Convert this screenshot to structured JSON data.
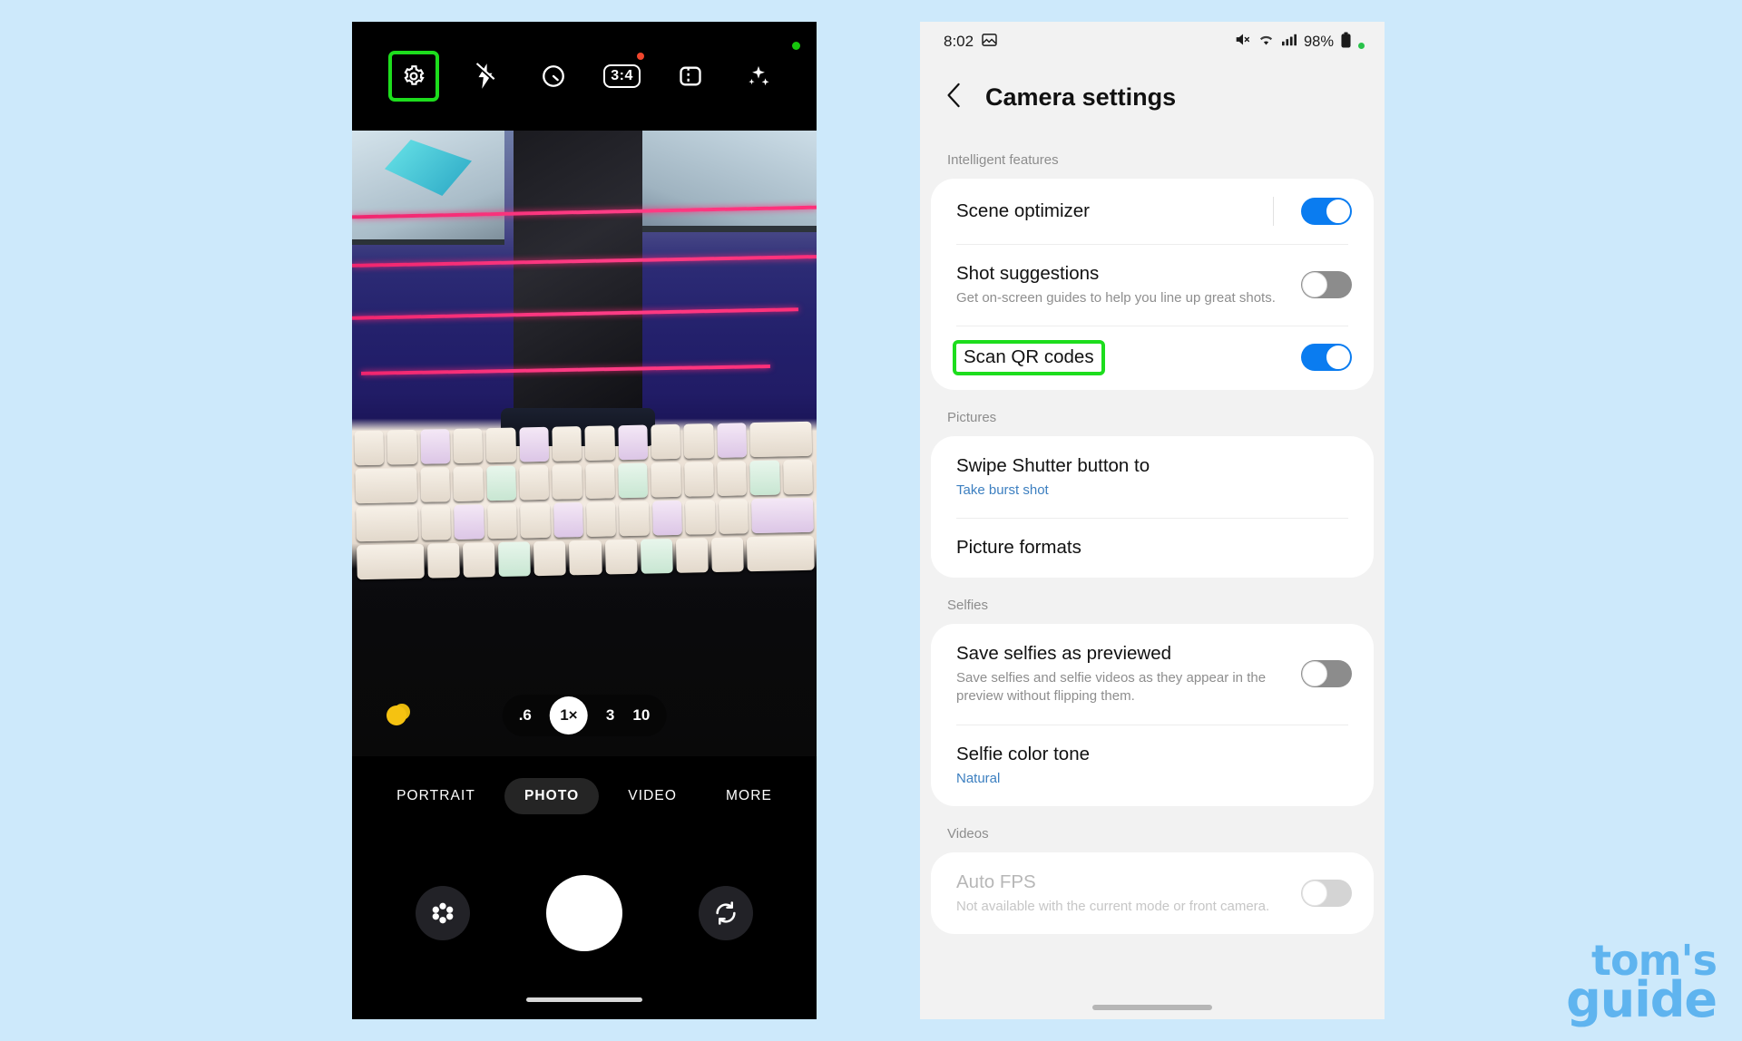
{
  "background_color": "#cde9fb",
  "highlight_color": "#1ddd1d",
  "accent_blue": "#0a7cf0",
  "camera_phone": {
    "toolbar": {
      "settings_icon": "gear-icon",
      "flash_icon": "flash-off-icon",
      "timer_icon": "timer-icon",
      "aspect_ratio_label": "3:4",
      "motion_photo_icon": "motion-photo-icon",
      "filters_icon": "magic-wand-icon"
    },
    "zoom": {
      "options": [
        ".6",
        "1×",
        "3",
        "10"
      ],
      "selected": "1×"
    },
    "modes": [
      "PORTRAIT",
      "PHOTO",
      "VIDEO",
      "MORE"
    ],
    "selected_mode": "PHOTO",
    "bottom_controls": {
      "filter_icon": "flower-filter-icon",
      "shutter_icon": "shutter-button",
      "switch_icon": "switch-camera-icon"
    }
  },
  "settings_phone": {
    "status_bar": {
      "time": "8:02",
      "photo_icon": "gallery-icon",
      "mute_icon": "mute-icon",
      "wifi_icon": "wifi-icon",
      "signal_icon": "cellular-icon",
      "battery_percent": "98%",
      "battery_icon": "battery-icon"
    },
    "header": {
      "back_icon": "back-chevron-icon",
      "title": "Camera settings"
    },
    "sections": [
      {
        "label": "Intelligent features",
        "rows": [
          {
            "title": "Scene optimizer",
            "subtitle": "",
            "control": "toggle",
            "state": "on",
            "has_divider": true,
            "highlighted": false
          },
          {
            "title": "Shot suggestions",
            "subtitle": "Get on-screen guides to help you line up great shots.",
            "control": "toggle",
            "state": "off",
            "has_divider": false,
            "highlighted": false
          },
          {
            "title": "Scan QR codes",
            "subtitle": "",
            "control": "toggle",
            "state": "on",
            "has_divider": false,
            "highlighted": true
          }
        ]
      },
      {
        "label": "Pictures",
        "rows": [
          {
            "title": "Swipe Shutter button to",
            "subtitle": "Take burst shot",
            "subtitle_style": "blue",
            "control": "none",
            "state": "",
            "highlighted": false
          },
          {
            "title": "Picture formats",
            "subtitle": "",
            "control": "none",
            "state": "",
            "highlighted": false
          }
        ]
      },
      {
        "label": "Selfies",
        "rows": [
          {
            "title": "Save selfies as previewed",
            "subtitle": "Save selfies and selfie videos as they appear in the preview without flipping them.",
            "control": "toggle",
            "state": "off",
            "highlighted": false
          },
          {
            "title": "Selfie color tone",
            "subtitle": "Natural",
            "subtitle_style": "blue",
            "control": "none",
            "state": "",
            "highlighted": false
          }
        ]
      },
      {
        "label": "Videos",
        "rows": [
          {
            "title": "Auto FPS",
            "subtitle": "Not available with the current mode or front camera.",
            "control": "toggle",
            "state": "off-disabled",
            "disabled": true,
            "highlighted": false
          }
        ]
      }
    ]
  },
  "watermark": {
    "line1": "tom's",
    "line2": "guide"
  }
}
